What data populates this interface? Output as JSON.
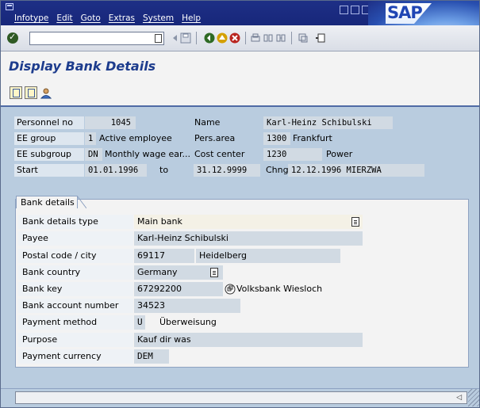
{
  "menu": [
    "Infotype",
    "Edit",
    "Goto",
    "Extras",
    "System",
    "Help"
  ],
  "logo_text": "SAP",
  "toolbar": {
    "command_value": "",
    "icons": [
      "enter-icon",
      "save-icon",
      "back-icon",
      "exit-icon",
      "cancel-icon",
      "print-icon",
      "find-icon",
      "find-next-icon",
      "create-session-icon",
      "help-icon"
    ]
  },
  "page_title": "Display Bank Details",
  "header": {
    "personnel_no_label": "Personnel no",
    "personnel_no": "1045",
    "name_label": "Name",
    "name": "Karl-Heinz Schibulski",
    "ee_group_label": "EE group",
    "ee_group_code": "1",
    "ee_group_text": "Active employee",
    "pers_area_label": "Pers.area",
    "pers_area_code": "1300",
    "pers_area_text": "Frankfurt",
    "ee_subgroup_label": "EE subgroup",
    "ee_subgroup_code": "DN",
    "ee_subgroup_text": "Monthly wage ear...",
    "cost_center_label": "Cost center",
    "cost_center_code": "1230",
    "cost_center_text": "Power",
    "start_label": "Start",
    "start_date": "01.01.1996",
    "to_label": "to",
    "end_date": "31.12.9999",
    "chng_label": "Chng",
    "chng_date": "12.12.1996",
    "chng_user": "MIERZWA"
  },
  "bank": {
    "tab_label": "Bank details",
    "fields": [
      {
        "label": "Bank details type",
        "value": "Main bank"
      },
      {
        "label": "Payee",
        "value": "Karl-Heinz Schibulski"
      },
      {
        "label": "Postal code / city",
        "value": "69117",
        "value2": "Heidelberg"
      },
      {
        "label": "Bank country",
        "value": "Germany"
      },
      {
        "label": "Bank key",
        "value": "67292200",
        "value2": "Volksbank Wiesloch"
      },
      {
        "label": "Bank account number",
        "value": "34523"
      },
      {
        "label": "Payment method",
        "value": "U",
        "value2": "Überweisung"
      },
      {
        "label": "Purpose",
        "value": "Kauf dir was"
      },
      {
        "label": "Payment currency",
        "value": "DEM"
      }
    ]
  },
  "status": {
    "text": ""
  }
}
